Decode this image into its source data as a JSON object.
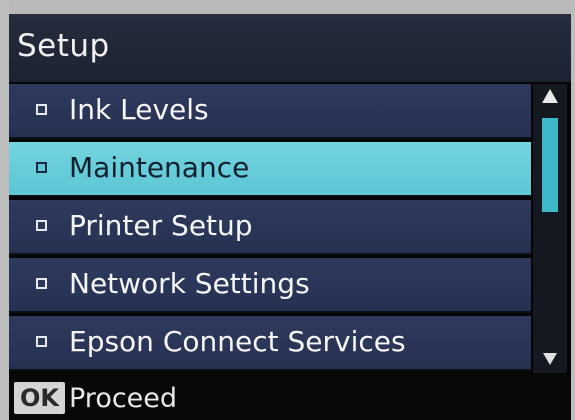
{
  "screen": {
    "title": "Setup"
  },
  "menu": {
    "items": [
      {
        "label": "Ink Levels",
        "selected": false
      },
      {
        "label": "Maintenance",
        "selected": true
      },
      {
        "label": "Printer Setup",
        "selected": false
      },
      {
        "label": "Network Settings",
        "selected": false
      },
      {
        "label": "Epson Connect Services",
        "selected": false
      }
    ]
  },
  "footer": {
    "key": "OK",
    "action": "Proceed"
  },
  "icons": {
    "bullet": "square-bullet-icon",
    "scroll_up": "scroll-up-arrow-icon",
    "scroll_down": "scroll-down-arrow-icon"
  },
  "colors": {
    "selected_row": "#5cc6d5",
    "row": "#2b3658",
    "title_bar": "#222a3b",
    "scroll_thumb": "#3fb8c7"
  }
}
